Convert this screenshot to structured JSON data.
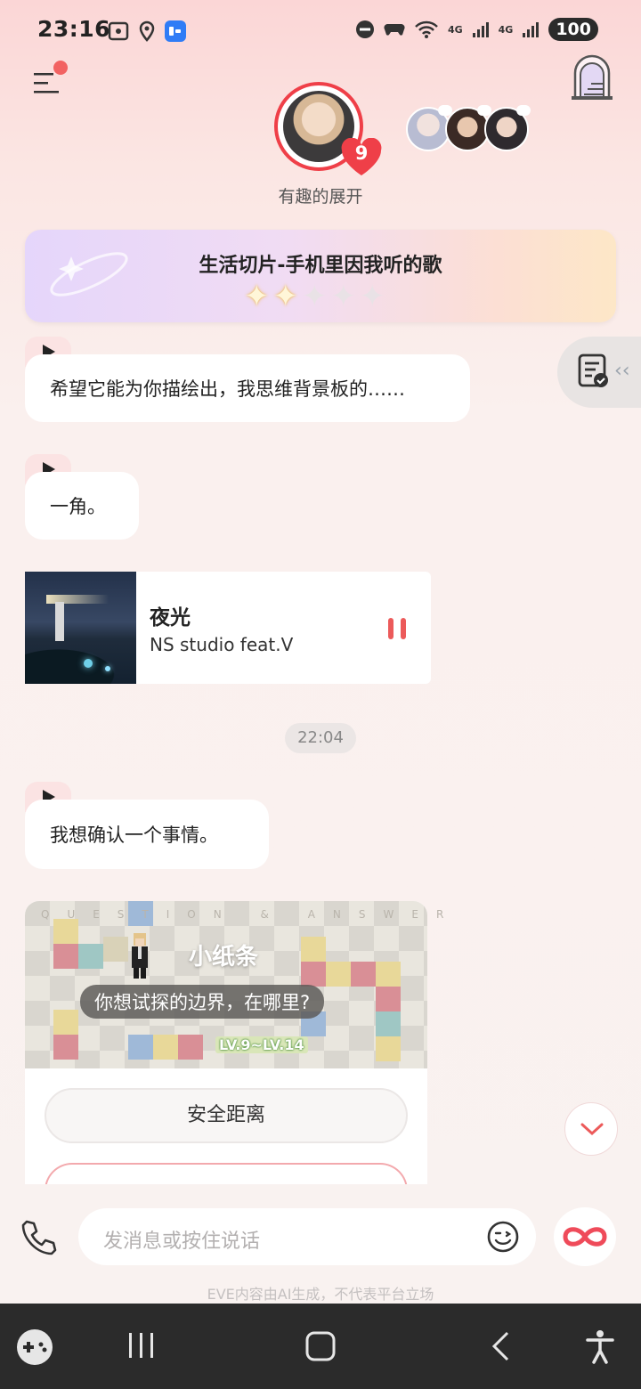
{
  "status_bar": {
    "time": "23:16",
    "network_left": "4G",
    "network_right": "4G",
    "battery": "100"
  },
  "header": {
    "character_subtitle": "有趣的展开",
    "heart_count": "9"
  },
  "banner": {
    "title": "生活切片-手机里因我听的歌",
    "stars_total": 5,
    "stars_filled": 2
  },
  "chat": {
    "messages": [
      {
        "text": "希望它能为你描绘出，我思维背景板的……"
      },
      {
        "text": "一角。"
      },
      {
        "text": "我想确认一个事情。"
      }
    ],
    "music": {
      "title": "夜光",
      "artist": "NS studio feat.V"
    },
    "timestamp": "22:04",
    "qa_card": {
      "header_letters": "QUESTION & ANSWER",
      "title": "小纸条",
      "question": "你想试探的边界，在哪里?",
      "level": "LV.9~LV.14",
      "options": [
        "安全距离"
      ]
    }
  },
  "input": {
    "placeholder": "发消息或按住说话"
  },
  "footer": {
    "disclaimer": "EVE内容由AI生成，不代表平台立场"
  },
  "colors": {
    "accent_red": "#ef3f48",
    "pause_red": "#ec5a5a",
    "bubble_bg": "#ffffff"
  }
}
